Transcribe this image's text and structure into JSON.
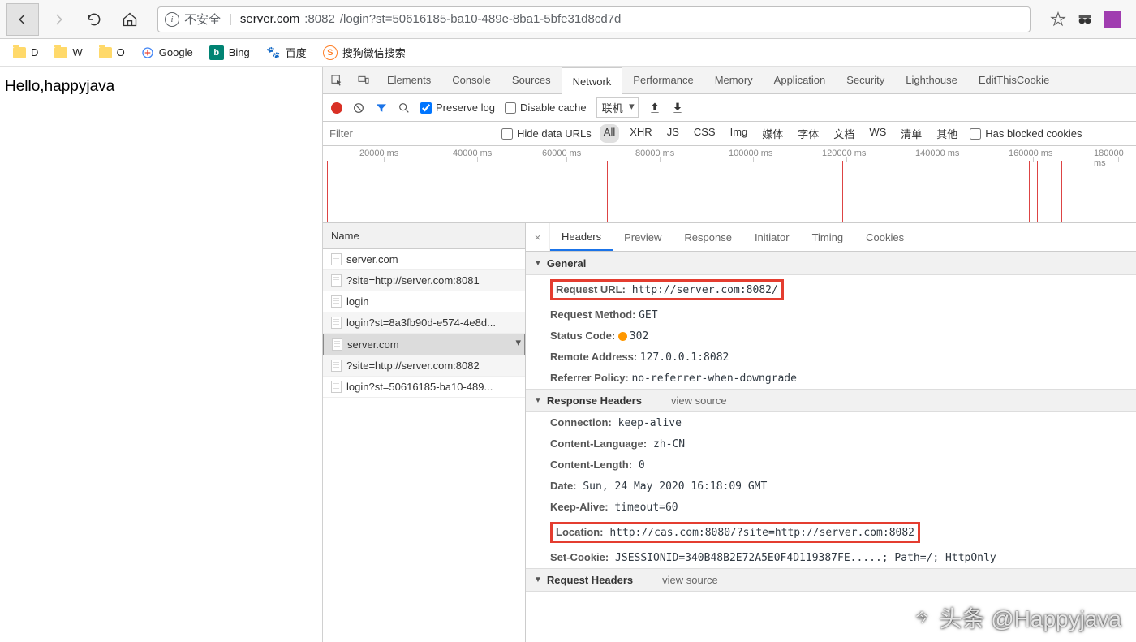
{
  "address": {
    "security": "不安全",
    "host": "server.com",
    "port": ":8082",
    "path": "/login?st=50616185-ba10-489e-8ba1-5bfe31d8cd7d"
  },
  "bookmarks": [
    {
      "label": "D"
    },
    {
      "label": "W"
    },
    {
      "label": "O"
    },
    {
      "label": "Google"
    },
    {
      "label": "Bing"
    },
    {
      "label": "百度"
    },
    {
      "label": "搜狗微信搜索"
    }
  ],
  "page_text": "Hello,happyjava",
  "devtools_tabs": [
    "Elements",
    "Console",
    "Sources",
    "Network",
    "Performance",
    "Memory",
    "Application",
    "Security",
    "Lighthouse",
    "EditThisCookie"
  ],
  "devtools_active": "Network",
  "net_tools": {
    "preserve_log": "Preserve log",
    "preserve_checked": true,
    "disable_cache": "Disable cache",
    "disable_checked": false,
    "throttle": "联机"
  },
  "filter": {
    "placeholder": "Filter",
    "hide_data": "Hide data URLs",
    "types": [
      "All",
      "XHR",
      "JS",
      "CSS",
      "Img",
      "媒体",
      "字体",
      "文档",
      "WS",
      "清单",
      "其他"
    ],
    "active_type": "All",
    "has_blocked": "Has blocked cookies"
  },
  "timeline_labels": [
    "20000 ms",
    "40000 ms",
    "60000 ms",
    "80000 ms",
    "100000 ms",
    "120000 ms",
    "140000 ms",
    "160000 ms",
    "180000 ms"
  ],
  "requests": {
    "head": "Name",
    "items": [
      "server.com",
      "?site=http://server.com:8081",
      "login",
      "login?st=8a3fb90d-e574-4e8d...",
      "server.com",
      "?site=http://server.com:8082",
      "login?st=50616185-ba10-489..."
    ],
    "selected_index": 4
  },
  "detail_tabs": [
    "Headers",
    "Preview",
    "Response",
    "Initiator",
    "Timing",
    "Cookies"
  ],
  "detail_active": "Headers",
  "general": {
    "title": "General",
    "request_url_k": "Request URL:",
    "request_url_v": "http://server.com:8082/",
    "request_method_k": "Request Method:",
    "request_method_v": "GET",
    "status_code_k": "Status Code:",
    "status_code_v": "302",
    "remote_addr_k": "Remote Address:",
    "remote_addr_v": "127.0.0.1:8082",
    "referrer_k": "Referrer Policy:",
    "referrer_v": "no-referrer-when-downgrade"
  },
  "response_headers": {
    "title": "Response Headers",
    "view_source": "view source",
    "items": [
      {
        "k": "Connection:",
        "v": "keep-alive"
      },
      {
        "k": "Content-Language:",
        "v": "zh-CN"
      },
      {
        "k": "Content-Length:",
        "v": "0"
      },
      {
        "k": "Date:",
        "v": "Sun, 24 May 2020 16:18:09 GMT"
      },
      {
        "k": "Keep-Alive:",
        "v": "timeout=60"
      },
      {
        "k": "Location:",
        "v": "http://cas.com:8080/?site=http://server.com:8082"
      },
      {
        "k": "Set-Cookie:",
        "v": "JSESSIONID=340B48B2E72A5E0F4D119387FE.....; Path=/; HttpOnly"
      }
    ]
  },
  "request_headers": {
    "title": "Request Headers",
    "view_source": "view source"
  },
  "watermark": "头条 @Happyjava"
}
